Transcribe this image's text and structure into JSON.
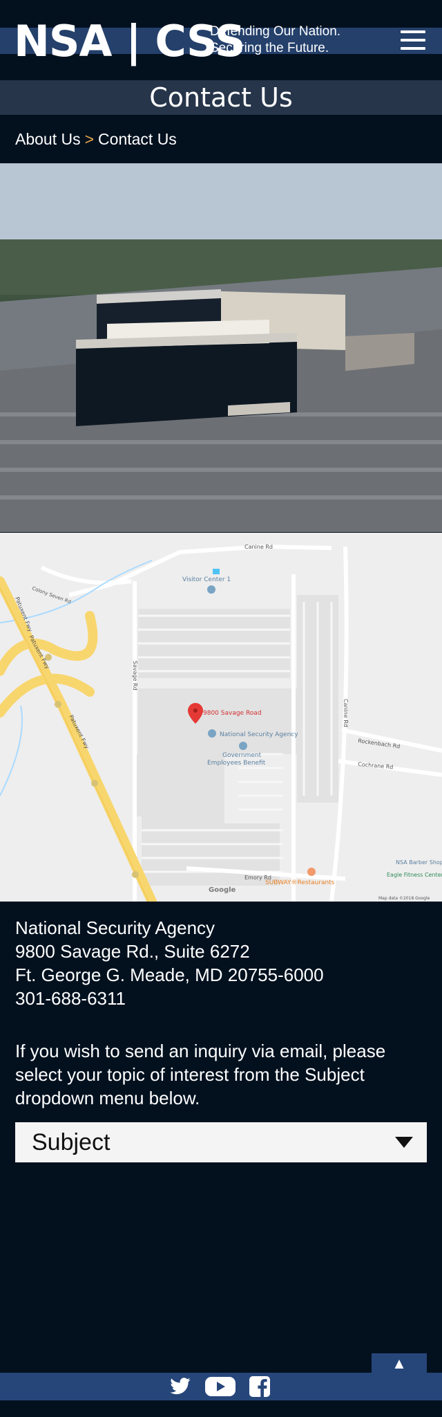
{
  "header": {
    "logo": "NSA | CSS",
    "tagline_line1": "Defending Our Nation.",
    "tagline_line2": "Securing the Future."
  },
  "page": {
    "title": "Contact Us"
  },
  "breadcrumb": {
    "parent": "About Us",
    "separator": ">",
    "current": "Contact Us"
  },
  "map": {
    "marker_label": "9800 Savage Road",
    "places": {
      "nsa": "National Security Agency",
      "gov_line1": "Government",
      "gov_line2": "Employees Benefit",
      "visitor": "Visitor Center 1",
      "subway": "SUBWAY®Restaurants",
      "barber": "NSA Barber Shop",
      "eagle": "Eagle Fitness Center"
    },
    "roads": {
      "canine_top": "Canine Rd",
      "canine_right": "Canine Rd",
      "rockenbach": "Rockenbach Rd",
      "cochrane": "Cochrane Rd",
      "emory": "Emory Rd",
      "savage": "Savage Rd",
      "patuxent1": "Patuxent Fwy",
      "patuxent2": "Patuxent Fwy",
      "patuxent3": "Patuxent Fwy",
      "colony": "Colony Seven Rd"
    },
    "attribution": "Map data ©2018 Google",
    "google": "Google"
  },
  "contact": {
    "org": "National Security Agency",
    "street": "9800 Savage Rd., Suite 6272",
    "city": "Ft. George G. Meade, MD 20755-6000",
    "phone": "301-688-6311"
  },
  "inquiry": {
    "text": "If you wish to send an inquiry via email, please select your topic of interest from the Subject dropdown menu below."
  },
  "subject_select": {
    "selected": "Subject"
  },
  "footer": {
    "back_to_top": "▲"
  },
  "icons": {
    "menu": "hamburger-menu-icon",
    "twitter": "twitter-icon",
    "youtube": "youtube-icon",
    "facebook": "facebook-icon",
    "marker": "map-marker-icon"
  },
  "colors": {
    "background": "#03111f",
    "band": "#24406b",
    "title_bar": "#26354a",
    "accent": "#e7a94a",
    "footer": "#26467a"
  }
}
